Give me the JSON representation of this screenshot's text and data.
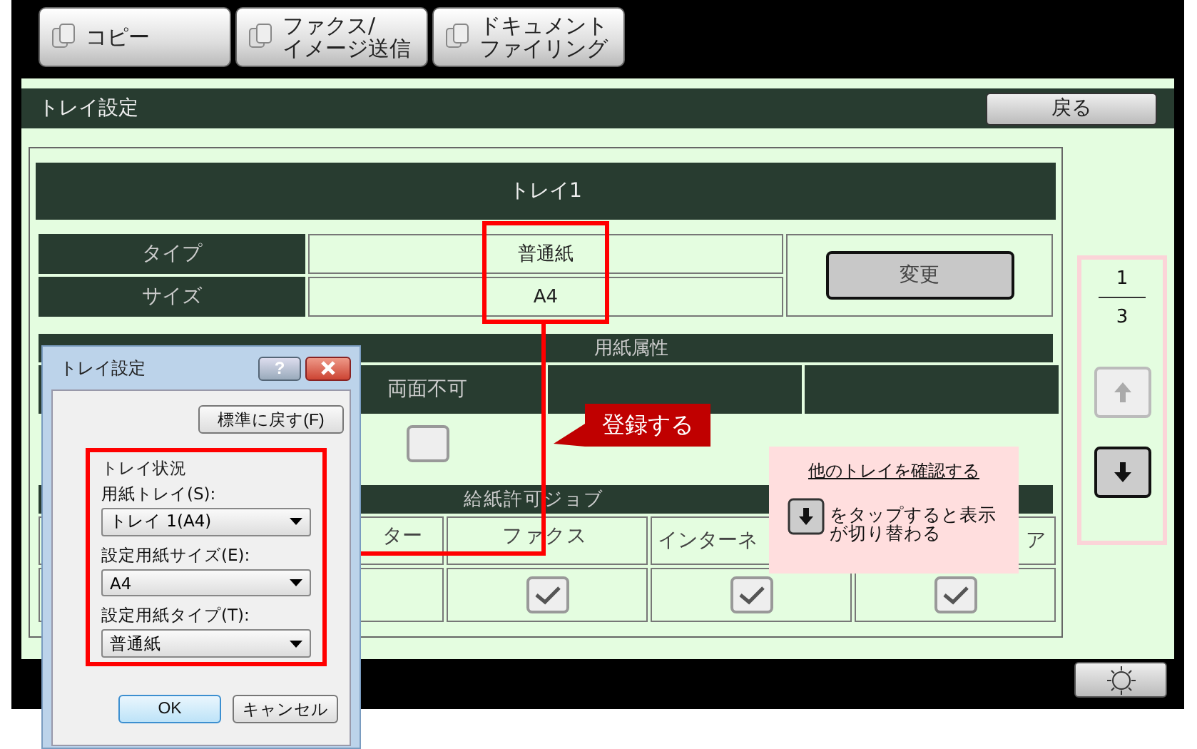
{
  "tabs": [
    {
      "lines": [
        "コピー"
      ],
      "selected": false
    },
    {
      "lines": [
        "ファクス/",
        "イメージ送信"
      ],
      "selected": false
    },
    {
      "lines": [
        "ドキュメント",
        "ファイリング"
      ],
      "selected": false
    }
  ],
  "header": {
    "title": "トレイ設定",
    "back": "戻る"
  },
  "tray": {
    "title": "トレイ1",
    "rows": [
      {
        "label": "タイプ",
        "value": "普通紙"
      },
      {
        "label": "サイズ",
        "value": "A4"
      }
    ],
    "change": "変更"
  },
  "attributes": {
    "title": "用紙属性",
    "columns": [
      {},
      {
        "label": "両面不可",
        "checked": false
      },
      {},
      {}
    ]
  },
  "jobs": {
    "title": "給紙許可ジョブ",
    "columns": [
      {
        "label": "ター"
      },
      {
        "label": "ファクス",
        "checked": true
      },
      {
        "label": "インターネ",
        "checked": true
      },
      {
        "label": "ア",
        "checked": true
      }
    ]
  },
  "pager": {
    "current": "1",
    "total": "3",
    "up_disabled": true,
    "down_disabled": false
  },
  "callout": "登録する",
  "hint": {
    "title": "他のトレイを確認する",
    "text": "をタップすると表示が切り替わる"
  },
  "dialog": {
    "title": "トレイ設定",
    "help": "?",
    "reset": "標準に戻す(F)",
    "group": "トレイ状況",
    "fields": [
      {
        "label": "用紙トレイ(S):",
        "value": "トレイ 1(A4)"
      },
      {
        "label": "設定用紙サイズ(E):",
        "value": "A4"
      },
      {
        "label": "設定用紙タイプ(T):",
        "value": "普通紙"
      }
    ],
    "ok": "OK",
    "cancel": "キャンセル"
  }
}
